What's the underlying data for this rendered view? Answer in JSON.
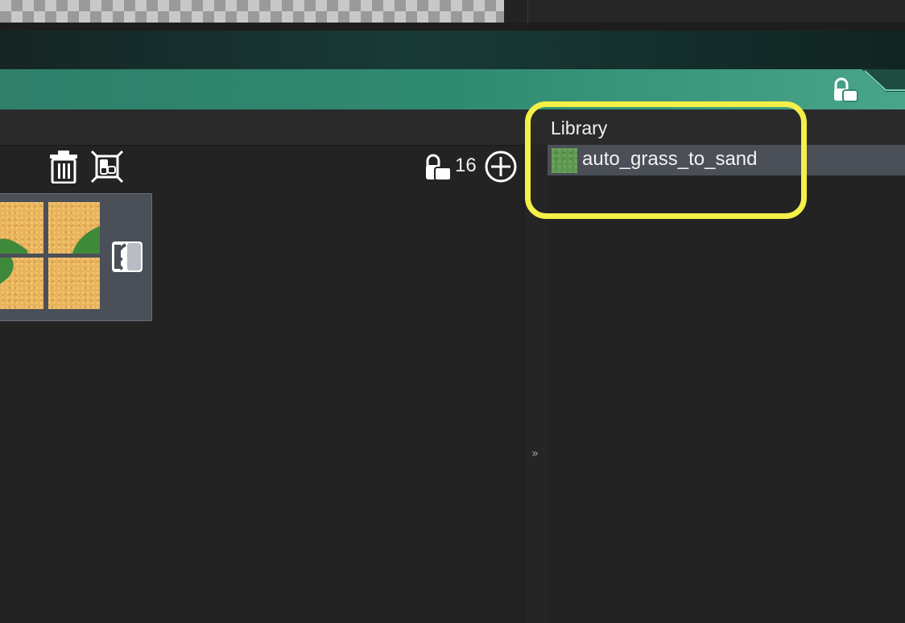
{
  "library": {
    "title": "Library",
    "items": [
      {
        "label": "auto_grass_to_sand",
        "icon": "grass-thumbnail"
      }
    ]
  },
  "toolbar": {
    "count": "16",
    "icons": [
      "trash-icon",
      "select-frame-icon",
      "lock-icon",
      "add-circle-icon"
    ]
  },
  "splitter": {
    "arrow": "»"
  },
  "colors": {
    "highlight": "#f4f048",
    "accent_band": "#2f8a70",
    "selected_row": "#4a4f58",
    "tile_sand": "#e9b45d",
    "tile_grass": "#3f8a3a"
  }
}
